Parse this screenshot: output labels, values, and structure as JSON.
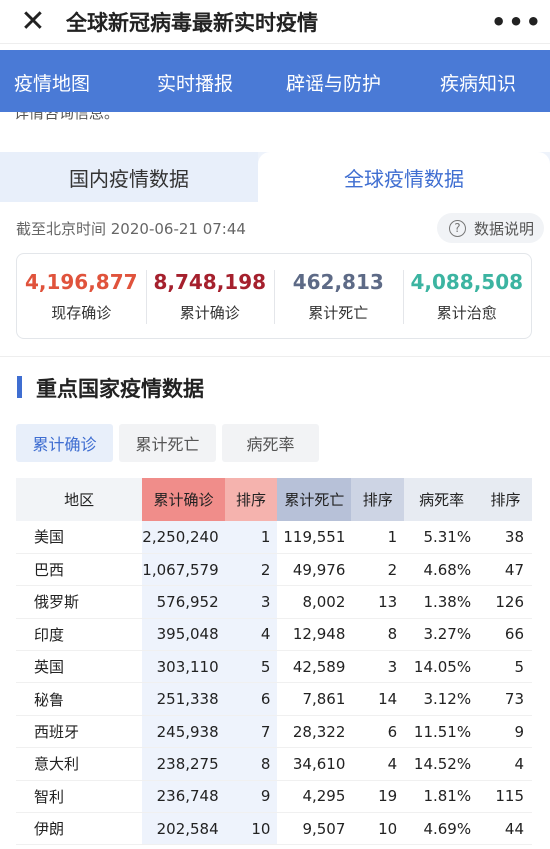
{
  "header": {
    "close_icon": "close-icon",
    "title": "全球新冠病毒最新实时疫情",
    "more_icon": "more-dots-icon"
  },
  "nav": [
    "疫情地图",
    "实时播报",
    "辟谣与防护",
    "疾病知识"
  ],
  "clipped_text": "详情咨询信息。",
  "tabs": {
    "domestic": "国内疫情数据",
    "global": "全球疫情数据"
  },
  "timestamp": "截至北京时间 2020-06-21 07:44",
  "explain_label": "数据说明",
  "stats": [
    {
      "value": "4,196,877",
      "label": "现存确诊",
      "color": "#e0533c"
    },
    {
      "value": "8,748,198",
      "label": "累计确诊",
      "color": "#a5202d"
    },
    {
      "value": "462,813",
      "label": "累计死亡",
      "color": "#5d6a86"
    },
    {
      "value": "4,088,508",
      "label": "累计治愈",
      "color": "#3cb4a1"
    }
  ],
  "section_title": "重点国家疫情数据",
  "subtabs": [
    "累计确诊",
    "累计死亡",
    "病死率"
  ],
  "table": {
    "headers": [
      "地区",
      "累计确诊",
      "排序",
      "累计死亡",
      "排序",
      "病死率",
      "排序"
    ],
    "rows": [
      [
        "美国",
        "2,250,240",
        "1",
        "119,551",
        "1",
        "5.31%",
        "38"
      ],
      [
        "巴西",
        "1,067,579",
        "2",
        "49,976",
        "2",
        "4.68%",
        "47"
      ],
      [
        "俄罗斯",
        "576,952",
        "3",
        "8,002",
        "13",
        "1.38%",
        "126"
      ],
      [
        "印度",
        "395,048",
        "4",
        "12,948",
        "8",
        "3.27%",
        "66"
      ],
      [
        "英国",
        "303,110",
        "5",
        "42,589",
        "3",
        "14.05%",
        "5"
      ],
      [
        "秘鲁",
        "251,338",
        "6",
        "7,861",
        "14",
        "3.12%",
        "73"
      ],
      [
        "西班牙",
        "245,938",
        "7",
        "28,322",
        "6",
        "11.51%",
        "9"
      ],
      [
        "意大利",
        "238,275",
        "8",
        "34,610",
        "4",
        "14.52%",
        "4"
      ],
      [
        "智利",
        "236,748",
        "9",
        "4,295",
        "19",
        "1.81%",
        "115"
      ],
      [
        "伊朗",
        "202,584",
        "10",
        "9,507",
        "10",
        "4.69%",
        "44"
      ]
    ]
  }
}
